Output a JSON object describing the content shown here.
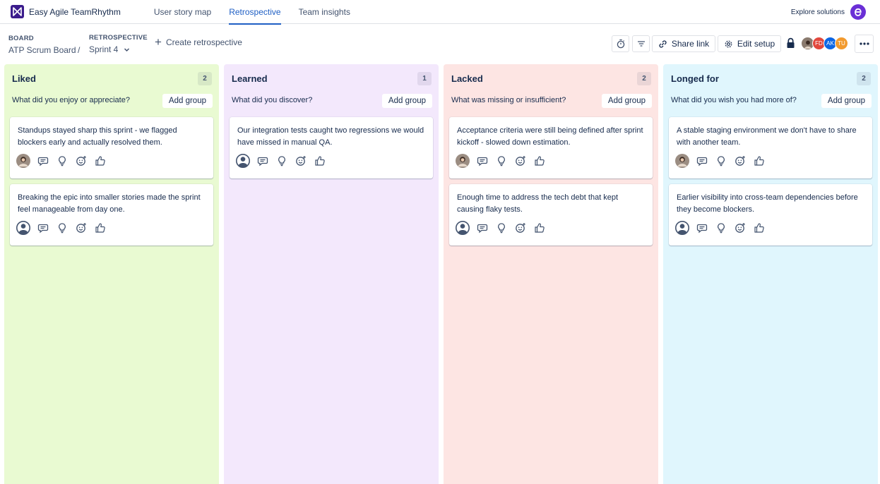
{
  "app": {
    "name": "Easy Agile TeamRhythm",
    "tabs": [
      {
        "label": "User story map"
      },
      {
        "label": "Retrospective"
      },
      {
        "label": "Team insights"
      }
    ],
    "explore_label": "Explore solutions"
  },
  "header": {
    "board_label": "BOARD",
    "board_value": "ATP Scrum Board",
    "separator": "/",
    "retro_label": "RETROSPECTIVE",
    "retro_value": "Sprint 4",
    "create_label": "Create retrospective",
    "share_label": "Share link",
    "edit_label": "Edit setup",
    "avatars": [
      {
        "initials": "",
        "color": "#8a7a6e"
      },
      {
        "initials": "FD",
        "color": "#e2483d"
      },
      {
        "initials": "AK",
        "color": "#0c66e4"
      },
      {
        "initials": "TU",
        "color": "#f29a2e"
      }
    ]
  },
  "columns": [
    {
      "title": "Liked",
      "count": "2",
      "prompt": "What did you enjoy or appreciate?",
      "add_group": "Add group",
      "color": "#e9fad2",
      "cards": [
        {
          "text": "Standups stayed sharp this sprint - we flagged blockers early and actually resolved them.",
          "author": "photo"
        },
        {
          "text": "Breaking the epic into smaller stories made the sprint feel manageable from day one.",
          "author": "anon"
        }
      ]
    },
    {
      "title": "Learned",
      "count": "1",
      "prompt": "What did you discover?",
      "add_group": "Add group",
      "color": "#f3e8fc",
      "cards": [
        {
          "text": "Our integration tests caught two regressions we would have missed in manual QA.",
          "author": "anon"
        }
      ]
    },
    {
      "title": "Lacked",
      "count": "2",
      "prompt": "What was missing or insufficient?",
      "add_group": "Add group",
      "color": "#fde5e3",
      "cards": [
        {
          "text": "Acceptance criteria were still being defined after sprint kickoff - slowed down estimation.",
          "author": "photo"
        },
        {
          "text": "Enough time to address the tech debt that kept causing flaky tests.",
          "author": "anon"
        }
      ]
    },
    {
      "title": "Longed for",
      "count": "2",
      "prompt": "What did you wish you had more of?",
      "add_group": "Add group",
      "color": "#e0f6fd",
      "cards": [
        {
          "text": "A stable staging environment we don't have to share with another team.",
          "author": "photo"
        },
        {
          "text": "Earlier visibility into cross-team dependencies before they become blockers.",
          "author": "anon"
        }
      ]
    }
  ]
}
